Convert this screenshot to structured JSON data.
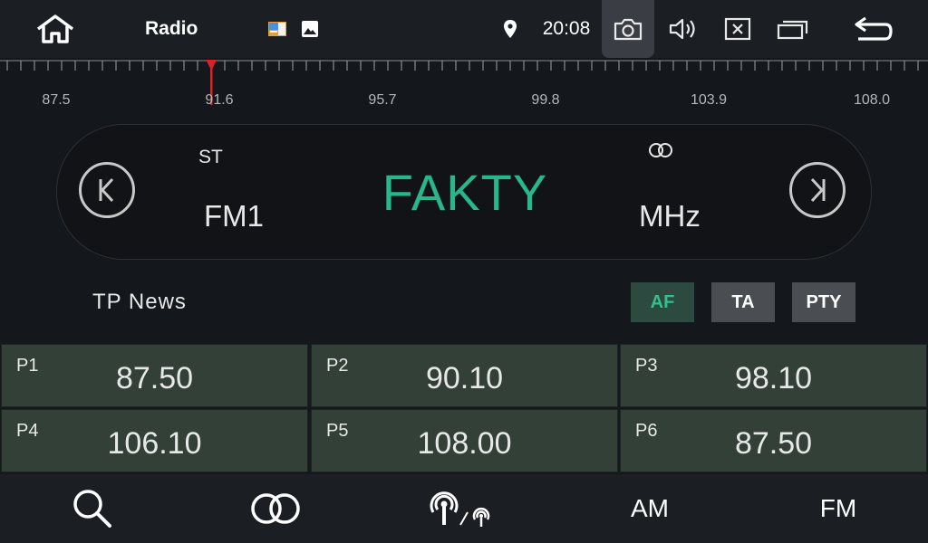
{
  "status_bar": {
    "title": "Radio",
    "clock": "20:08",
    "icons": [
      "home-icon",
      "photo-notification-icon",
      "gallery-notification-icon",
      "location-icon",
      "camera-icon",
      "volume-icon",
      "close-window-icon",
      "recent-apps-icon",
      "back-arrow-icon"
    ]
  },
  "scale": {
    "labels": [
      "87.5",
      "91.6",
      "95.7",
      "99.8",
      "103.9",
      "108.0"
    ],
    "min": 87.5,
    "max": 108.0,
    "marker_freq": 91.4,
    "marker_color": "#e02020"
  },
  "station": {
    "st_label": "ST",
    "band": "FM1",
    "name": "FAKTY",
    "unit": "MHz",
    "name_color": "#28b78a"
  },
  "rds": {
    "info": "TP  News",
    "af_label": "AF",
    "ta_label": "TA",
    "pty_label": "PTY",
    "af_active": true
  },
  "presets": [
    {
      "num": "P1",
      "freq": "87.50"
    },
    {
      "num": "P2",
      "freq": "90.10"
    },
    {
      "num": "P3",
      "freq": "98.10"
    },
    {
      "num": "P4",
      "freq": "106.10"
    },
    {
      "num": "P5",
      "freq": "108.00"
    },
    {
      "num": "P6",
      "freq": "87.50"
    }
  ],
  "bottom_bar": {
    "am_label": "AM",
    "fm_label": "FM",
    "icons": [
      "search-icon",
      "stereo-icon",
      "dx-local-icon"
    ]
  },
  "colors": {
    "accent": "#28b78a",
    "preset_bg": "#324038",
    "bar_bg": "#1b1e22"
  }
}
